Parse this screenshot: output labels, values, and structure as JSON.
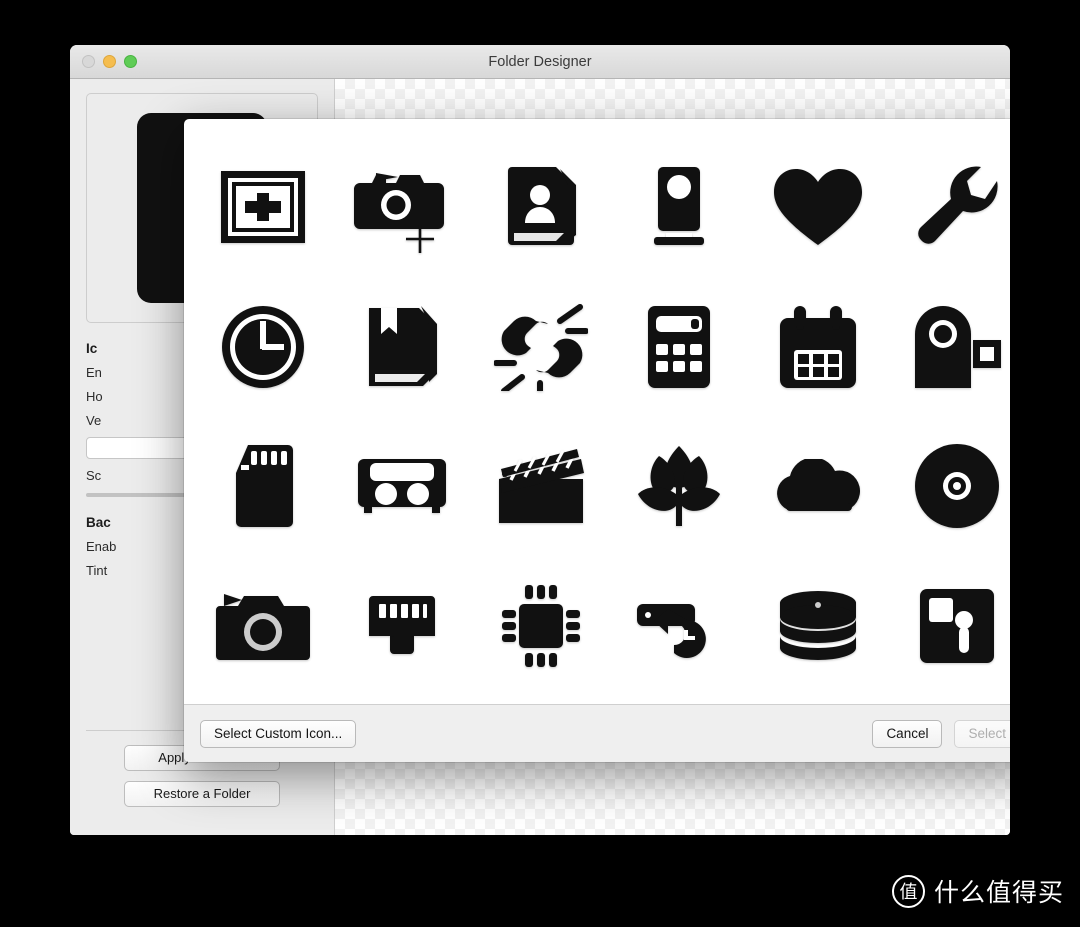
{
  "window": {
    "title": "Folder Designer",
    "traffic_lights": [
      "close-button",
      "minimize-button",
      "zoom-button"
    ]
  },
  "sidebar": {
    "icon_section": {
      "title": "Ic",
      "rows": [
        "En",
        "Ho",
        "Ve"
      ],
      "scale_label": "Sc"
    },
    "background_section": {
      "title": "Bac",
      "rows": [
        "Enab",
        "Tint"
      ]
    },
    "buttons": [
      {
        "label": "Apply to Folder"
      },
      {
        "label": "Restore a Folder"
      }
    ]
  },
  "modal": {
    "icons": [
      {
        "name": "add-frame-icon",
        "label": "Add Frame"
      },
      {
        "name": "camera-capture-icon",
        "label": "Screen Capture"
      },
      {
        "name": "contacts-book-icon",
        "label": "Contacts"
      },
      {
        "name": "webcam-icon",
        "label": "Webcam"
      },
      {
        "name": "heart-icon",
        "label": "Favorites"
      },
      {
        "name": "wrench-icon",
        "label": "Utilities"
      },
      {
        "name": "clock-icon",
        "label": "Clock"
      },
      {
        "name": "book-bookmark-icon",
        "label": "Book"
      },
      {
        "name": "broken-link-icon",
        "label": "Broken Link"
      },
      {
        "name": "calculator-icon",
        "label": "Calculator"
      },
      {
        "name": "calendar-icon",
        "label": "Calendar"
      },
      {
        "name": "camcorder-icon",
        "label": "Camcorder"
      },
      {
        "name": "sd-card-icon",
        "label": "SD Card"
      },
      {
        "name": "cassette-tape-icon",
        "label": "Cassette"
      },
      {
        "name": "clapperboard-icon",
        "label": "Movie"
      },
      {
        "name": "flower-icon",
        "label": "Flower"
      },
      {
        "name": "cloud-icon",
        "label": "Cloud"
      },
      {
        "name": "compact-disc-icon",
        "label": "Disc"
      },
      {
        "name": "photo-camera-icon",
        "label": "Camera"
      },
      {
        "name": "ethernet-port-icon",
        "label": "Ethernet"
      },
      {
        "name": "cpu-chip-icon",
        "label": "CPU"
      },
      {
        "name": "time-machine-icon",
        "label": "Time Machine"
      },
      {
        "name": "database-stack-icon",
        "label": "Database"
      },
      {
        "name": "memory-card-icon",
        "label": "Memory Card"
      }
    ],
    "footer": {
      "custom_icon_label": "Select Custom Icon...",
      "cancel_label": "Cancel",
      "select_label": "Select",
      "select_enabled": false
    }
  },
  "watermark": {
    "badge": "值",
    "text": "什么值得买"
  },
  "colors": {
    "icon_fill": "#111111",
    "scrollbar": "#6aaedc",
    "titlebar_top": "#e9e9e9",
    "sidebar_bg": "#ececec"
  }
}
